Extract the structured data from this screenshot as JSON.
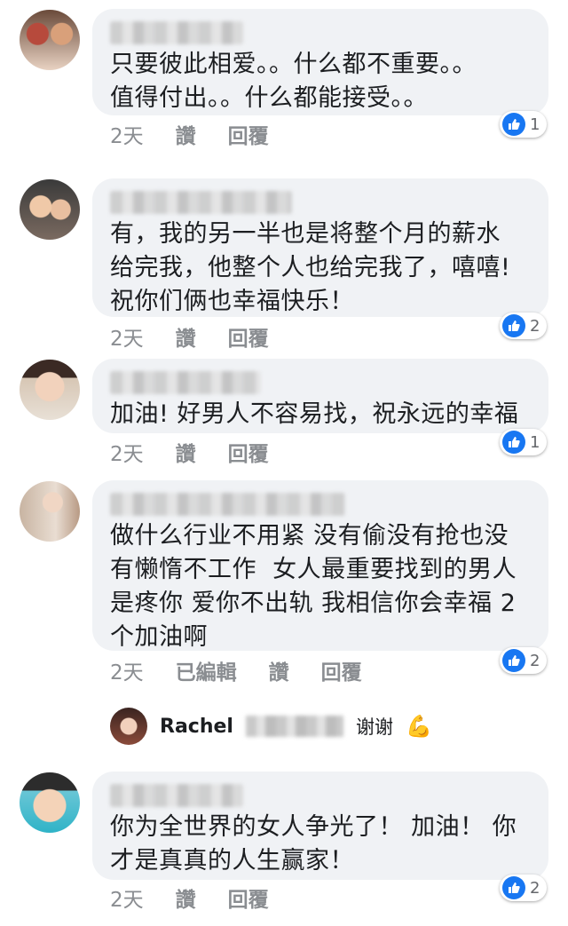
{
  "comments": [
    {
      "text": "只要彼此相爱。。什么都不重要。。\n值得付出。。什么都能接受。。",
      "age": "2天",
      "like": "讚",
      "reply": "回覆",
      "reactions": "1"
    },
    {
      "text": "有，我的另一半也是将整个月的薪水\n给完我，他整个人也给完我了，嘻嘻!\n祝你们俩也幸福快乐！",
      "age": "2天",
      "like": "讚",
      "reply": "回覆",
      "reactions": "2"
    },
    {
      "text": "加油! 好男人不容易找，祝永远的幸福",
      "age": "2天",
      "like": "讚",
      "reply": "回覆",
      "reactions": "1"
    },
    {
      "text": "做什么行业不用紧 没有偷没有抢也没\n有懒惰不工作  女人最重要找到的男人\n是疼你 爱你不出轨 我相信你会幸福 2\n个加油啊",
      "age": "2天",
      "edited": "已編輯",
      "like": "讚",
      "reply": "回覆",
      "reactions": "2"
    },
    {
      "text": "你为全世界的女人争光了！ 加油！ 你\n才是真真的人生赢家！",
      "age": "2天",
      "like": "讚",
      "reply": "回覆",
      "reactions": "2"
    }
  ],
  "reply_preview": {
    "name": "Rachel",
    "text": "谢谢",
    "emoji": "💪"
  },
  "colors": {
    "bubble": "#f0f2f5",
    "like_blue": "#1877f2",
    "meta_gray": "#8a8d91"
  }
}
